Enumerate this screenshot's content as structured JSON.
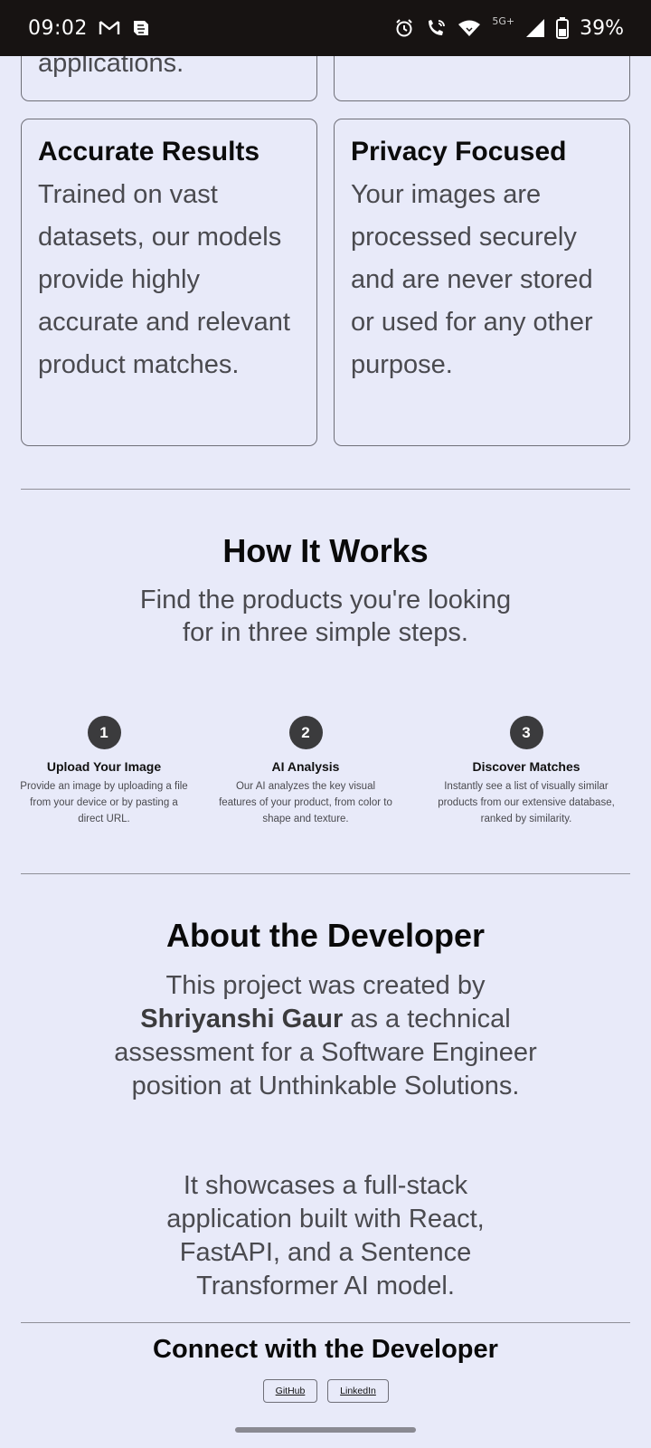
{
  "statusbar": {
    "time": "09:02",
    "network": "5G+",
    "battery": "39%",
    "icons": [
      "gmail-icon",
      "app-icon",
      "alarm-icon",
      "wifi-call-icon",
      "wifi-icon",
      "signal-icon",
      "battery-icon"
    ]
  },
  "cards": {
    "partial_left_text": "applications.",
    "accurate_title": "Accurate Results",
    "accurate_desc": "Trained on vast datasets, our models provide highly accurate and relevant product matches.",
    "privacy_title": "Privacy Focused",
    "privacy_desc": "Your images are processed securely and are never stored or used for any other purpose."
  },
  "how": {
    "title": "How It Works",
    "subtitle": "Find the products you're looking for in three simple steps.",
    "steps": [
      {
        "num": "1",
        "title": "Upload Your Image",
        "desc": "Provide an image by uploading a file from your device or by pasting a direct URL."
      },
      {
        "num": "2",
        "title": "AI Analysis",
        "desc": "Our AI analyzes the key visual features of your product, from color to shape and texture."
      },
      {
        "num": "3",
        "title": "Discover Matches",
        "desc": "Instantly see a list of visually similar products from our extensive database, ranked by similarity."
      }
    ]
  },
  "about": {
    "title": "About the Developer",
    "p1_before": "This project was created by",
    "p1_name": "Shriyanshi Gaur",
    "p1_after": "as a technical assessment for a Software Engineer position at Unthinkable Solutions.",
    "p2": "It showcases a full-stack application built with React, FastAPI, and a Sentence Transformer AI model."
  },
  "connect": {
    "title": "Connect with the Developer",
    "github": "GitHub",
    "linkedin": "LinkedIn"
  },
  "colors": {
    "background": "#e8eaf9",
    "step_circle": "#3b3b3d",
    "statusbar": "#171312"
  }
}
